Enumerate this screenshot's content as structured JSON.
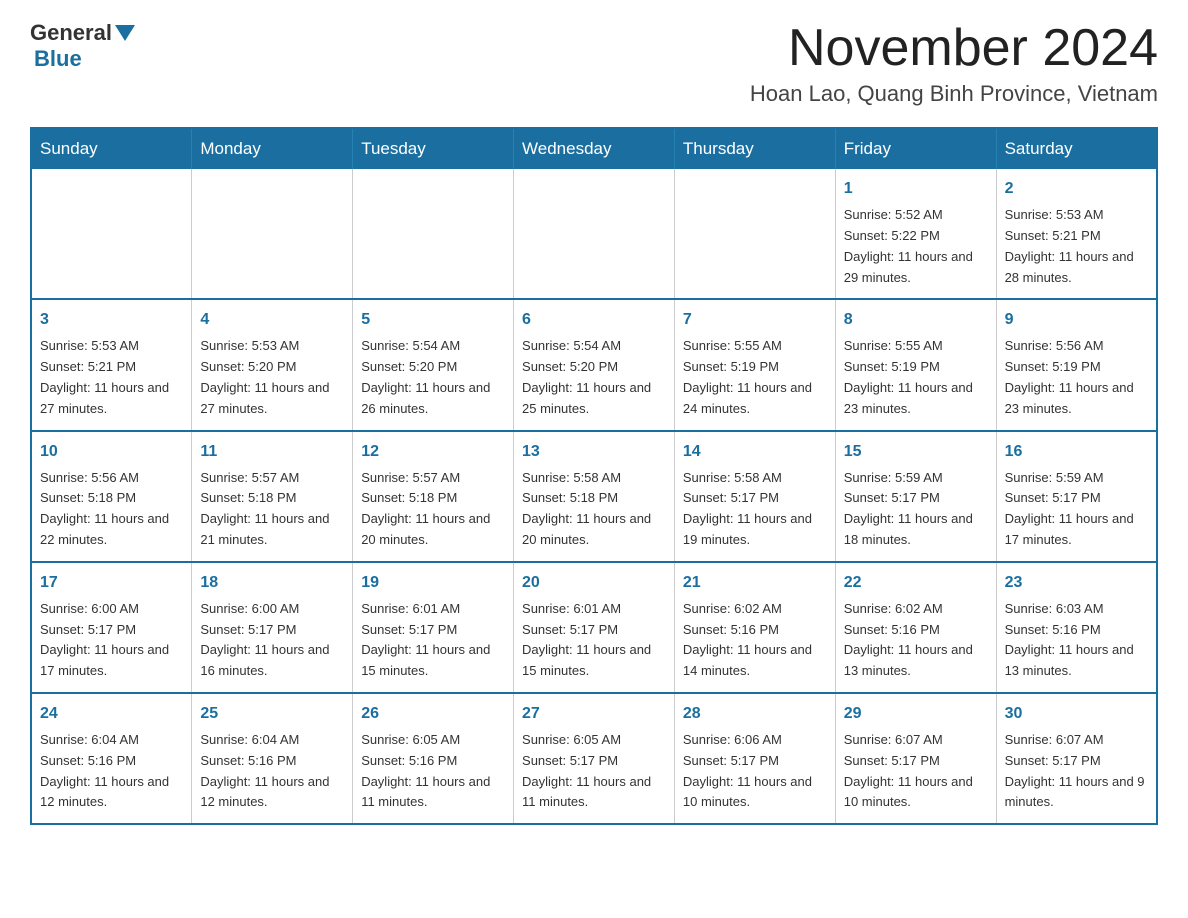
{
  "header": {
    "logo_general": "General",
    "logo_blue": "Blue",
    "month_title": "November 2024",
    "location": "Hoan Lao, Quang Binh Province, Vietnam"
  },
  "days_of_week": [
    "Sunday",
    "Monday",
    "Tuesday",
    "Wednesday",
    "Thursday",
    "Friday",
    "Saturday"
  ],
  "weeks": [
    [
      {
        "day": "",
        "info": ""
      },
      {
        "day": "",
        "info": ""
      },
      {
        "day": "",
        "info": ""
      },
      {
        "day": "",
        "info": ""
      },
      {
        "day": "",
        "info": ""
      },
      {
        "day": "1",
        "info": "Sunrise: 5:52 AM\nSunset: 5:22 PM\nDaylight: 11 hours and 29 minutes."
      },
      {
        "day": "2",
        "info": "Sunrise: 5:53 AM\nSunset: 5:21 PM\nDaylight: 11 hours and 28 minutes."
      }
    ],
    [
      {
        "day": "3",
        "info": "Sunrise: 5:53 AM\nSunset: 5:21 PM\nDaylight: 11 hours and 27 minutes."
      },
      {
        "day": "4",
        "info": "Sunrise: 5:53 AM\nSunset: 5:20 PM\nDaylight: 11 hours and 27 minutes."
      },
      {
        "day": "5",
        "info": "Sunrise: 5:54 AM\nSunset: 5:20 PM\nDaylight: 11 hours and 26 minutes."
      },
      {
        "day": "6",
        "info": "Sunrise: 5:54 AM\nSunset: 5:20 PM\nDaylight: 11 hours and 25 minutes."
      },
      {
        "day": "7",
        "info": "Sunrise: 5:55 AM\nSunset: 5:19 PM\nDaylight: 11 hours and 24 minutes."
      },
      {
        "day": "8",
        "info": "Sunrise: 5:55 AM\nSunset: 5:19 PM\nDaylight: 11 hours and 23 minutes."
      },
      {
        "day": "9",
        "info": "Sunrise: 5:56 AM\nSunset: 5:19 PM\nDaylight: 11 hours and 23 minutes."
      }
    ],
    [
      {
        "day": "10",
        "info": "Sunrise: 5:56 AM\nSunset: 5:18 PM\nDaylight: 11 hours and 22 minutes."
      },
      {
        "day": "11",
        "info": "Sunrise: 5:57 AM\nSunset: 5:18 PM\nDaylight: 11 hours and 21 minutes."
      },
      {
        "day": "12",
        "info": "Sunrise: 5:57 AM\nSunset: 5:18 PM\nDaylight: 11 hours and 20 minutes."
      },
      {
        "day": "13",
        "info": "Sunrise: 5:58 AM\nSunset: 5:18 PM\nDaylight: 11 hours and 20 minutes."
      },
      {
        "day": "14",
        "info": "Sunrise: 5:58 AM\nSunset: 5:17 PM\nDaylight: 11 hours and 19 minutes."
      },
      {
        "day": "15",
        "info": "Sunrise: 5:59 AM\nSunset: 5:17 PM\nDaylight: 11 hours and 18 minutes."
      },
      {
        "day": "16",
        "info": "Sunrise: 5:59 AM\nSunset: 5:17 PM\nDaylight: 11 hours and 17 minutes."
      }
    ],
    [
      {
        "day": "17",
        "info": "Sunrise: 6:00 AM\nSunset: 5:17 PM\nDaylight: 11 hours and 17 minutes."
      },
      {
        "day": "18",
        "info": "Sunrise: 6:00 AM\nSunset: 5:17 PM\nDaylight: 11 hours and 16 minutes."
      },
      {
        "day": "19",
        "info": "Sunrise: 6:01 AM\nSunset: 5:17 PM\nDaylight: 11 hours and 15 minutes."
      },
      {
        "day": "20",
        "info": "Sunrise: 6:01 AM\nSunset: 5:17 PM\nDaylight: 11 hours and 15 minutes."
      },
      {
        "day": "21",
        "info": "Sunrise: 6:02 AM\nSunset: 5:16 PM\nDaylight: 11 hours and 14 minutes."
      },
      {
        "day": "22",
        "info": "Sunrise: 6:02 AM\nSunset: 5:16 PM\nDaylight: 11 hours and 13 minutes."
      },
      {
        "day": "23",
        "info": "Sunrise: 6:03 AM\nSunset: 5:16 PM\nDaylight: 11 hours and 13 minutes."
      }
    ],
    [
      {
        "day": "24",
        "info": "Sunrise: 6:04 AM\nSunset: 5:16 PM\nDaylight: 11 hours and 12 minutes."
      },
      {
        "day": "25",
        "info": "Sunrise: 6:04 AM\nSunset: 5:16 PM\nDaylight: 11 hours and 12 minutes."
      },
      {
        "day": "26",
        "info": "Sunrise: 6:05 AM\nSunset: 5:16 PM\nDaylight: 11 hours and 11 minutes."
      },
      {
        "day": "27",
        "info": "Sunrise: 6:05 AM\nSunset: 5:17 PM\nDaylight: 11 hours and 11 minutes."
      },
      {
        "day": "28",
        "info": "Sunrise: 6:06 AM\nSunset: 5:17 PM\nDaylight: 11 hours and 10 minutes."
      },
      {
        "day": "29",
        "info": "Sunrise: 6:07 AM\nSunset: 5:17 PM\nDaylight: 11 hours and 10 minutes."
      },
      {
        "day": "30",
        "info": "Sunrise: 6:07 AM\nSunset: 5:17 PM\nDaylight: 11 hours and 9 minutes."
      }
    ]
  ]
}
